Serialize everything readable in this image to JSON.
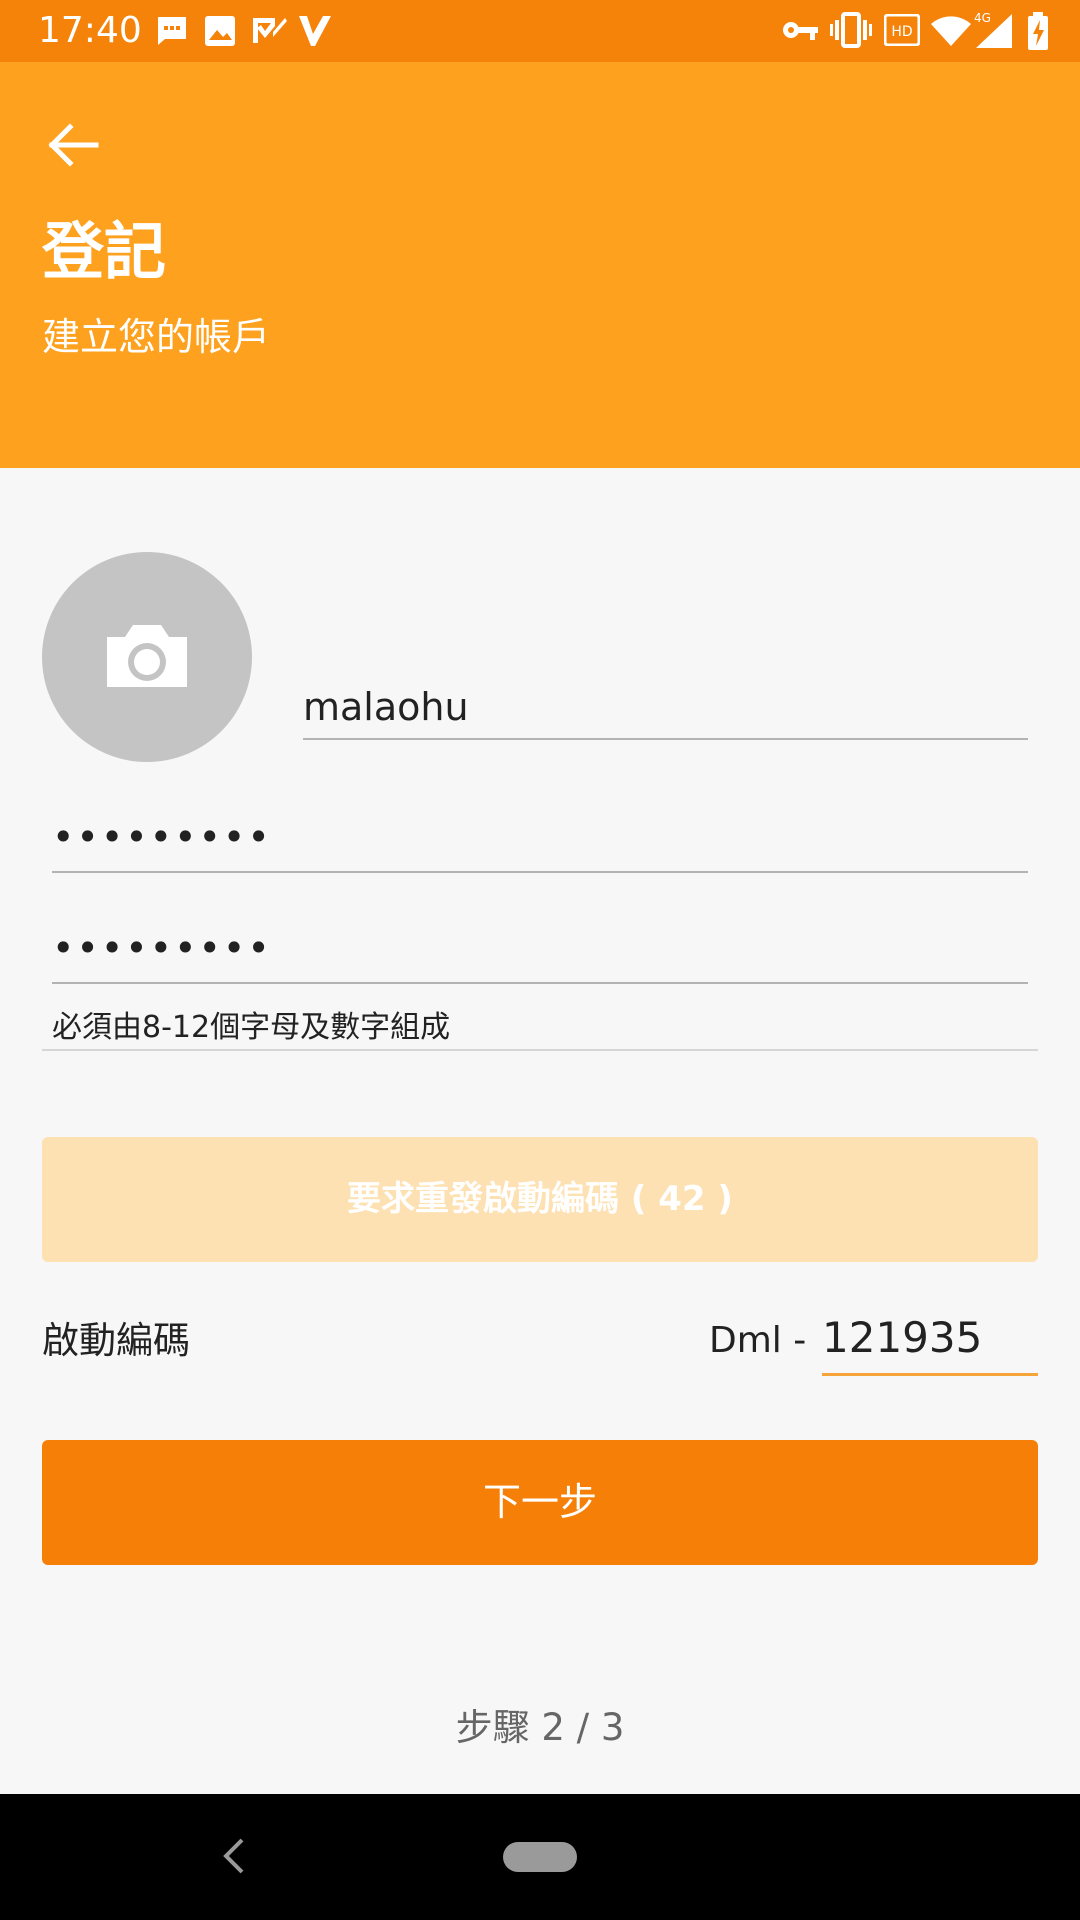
{
  "status_bar": {
    "time": "17:40",
    "left_icons": [
      "message-icon",
      "image-icon",
      "check-icon",
      "v-icon"
    ],
    "right_icons": [
      "key-icon",
      "vibrate-icon",
      "hd-icon",
      "wifi-icon",
      "signal-4g-icon",
      "battery-charging-icon"
    ],
    "network_label": "4G",
    "hd_label": "HD"
  },
  "header": {
    "back_icon": "arrow-left-icon",
    "title": "登記",
    "subtitle": "建立您的帳戶"
  },
  "form": {
    "avatar_icon": "camera-icon",
    "username": "malaohu",
    "password": "•••••••••",
    "confirm_password": "•••••••••",
    "hint": "必須由8-12個字母及數字組成",
    "resend_button": "要求重發啟動編碼 ( 42 )",
    "activation_label": "啟動編碼",
    "code_prefix": "Dml -",
    "activation_code": "121935",
    "next_button": "下一步",
    "step": "步驟 2 / 3"
  },
  "colors": {
    "status_bar": "#f5830a",
    "header": "#fda11e",
    "primary_button": "#f68007",
    "disabled_button": "#fde1b3",
    "accent_underline": "#f7a43a"
  },
  "nav_bar": {
    "icons": [
      "nav-back-icon",
      "nav-home-pill"
    ]
  }
}
